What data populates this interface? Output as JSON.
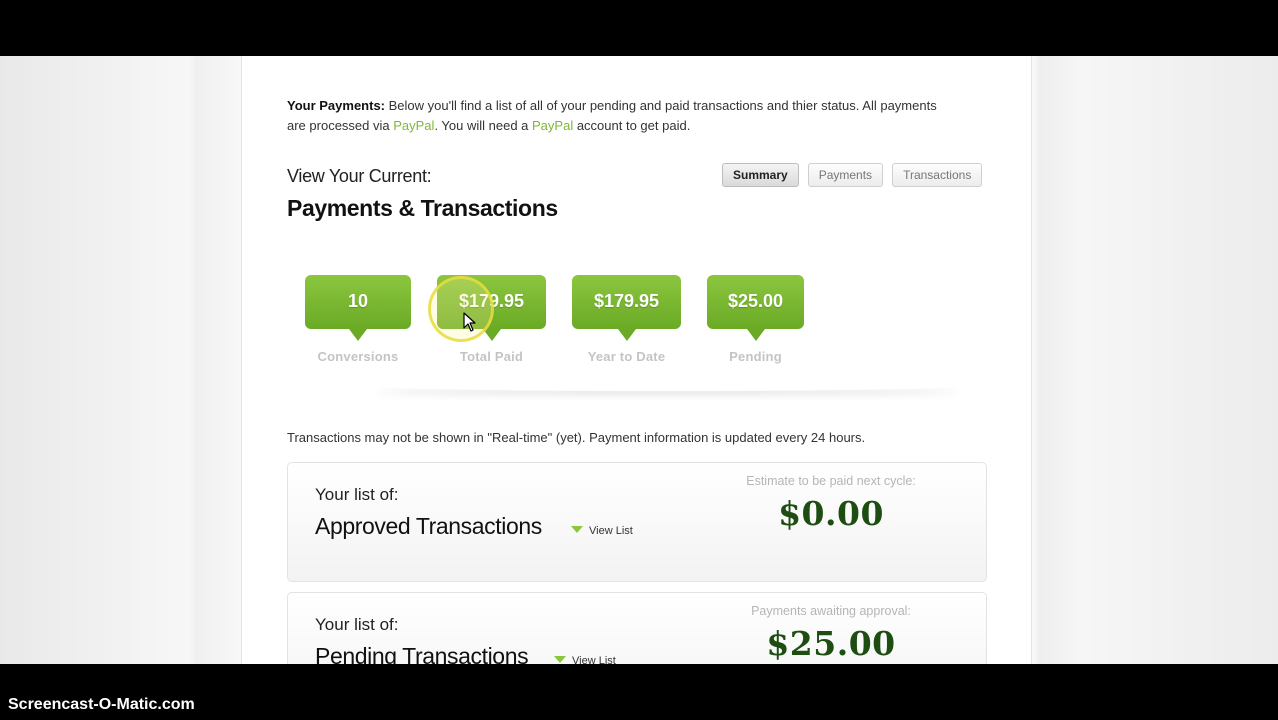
{
  "intro": {
    "lead": "Your Payments:",
    "text_1": " Below you'll find a list of all of your pending and paid transactions and thier status. All payments are processed via ",
    "paypal_1": "PayPal",
    "text_2": ". You will need a ",
    "paypal_2": "PayPal",
    "text_3": " account to get paid."
  },
  "header": {
    "view_current": "View Your Current:",
    "title": "Payments & Transactions"
  },
  "tabs": [
    {
      "label": "Summary",
      "active": true
    },
    {
      "label": "Payments",
      "active": false
    },
    {
      "label": "Transactions",
      "active": false
    }
  ],
  "stats": [
    {
      "value": "10",
      "label": "Conversions"
    },
    {
      "value": "$179.95",
      "label": "Total Paid"
    },
    {
      "value": "$179.95",
      "label": "Year to Date"
    },
    {
      "value": "$25.00",
      "label": "Pending"
    }
  ],
  "note": "Transactions may not be shown in \"Real-time\" (yet). Payment information is updated every 24 hours.",
  "cards": [
    {
      "pre": "Your list of:",
      "title": "Approved Transactions",
      "view_list": "View List",
      "caption": "Estimate to be paid next cycle:",
      "amount": "$0.00"
    },
    {
      "pre": "Your list of:",
      "title": "Pending Transactions",
      "view_list": "View List",
      "caption": "Payments awaiting approval:",
      "amount": "$25.00"
    }
  ],
  "watermark": "Screencast-O-Matic.com",
  "colors": {
    "accent_green": "#8cc63f",
    "amount_green": "#1e4d12",
    "link_green": "#7eb73a"
  }
}
